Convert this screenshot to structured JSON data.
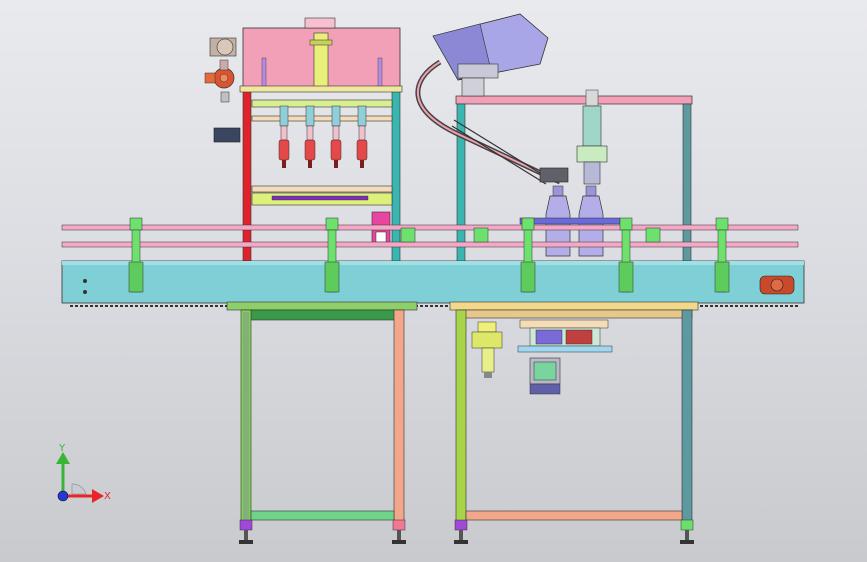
{
  "viewport": {
    "background_top": "#e9eaee",
    "background_bottom": "#c8cace"
  },
  "triad": {
    "x_label": "X",
    "y_label": "Y",
    "x_color": "#e8262a",
    "y_color": "#38b534",
    "z_color": "#2438d8"
  },
  "palette": {
    "conveyor": "#7fcfd6",
    "filler_head": "#f2a0b8",
    "frame_left_red": "#e0232b",
    "frame_teal": "#3ab6b0",
    "frame_green": "#7fd44a",
    "frame_salmon": "#f2a78a",
    "capper_hopper": "#a9a6e8",
    "bottle": "#b4aee8",
    "guide_rail_pink": "#f4a7c6",
    "bracket_green": "#6ee06e",
    "nozzle_red": "#e54848"
  }
}
